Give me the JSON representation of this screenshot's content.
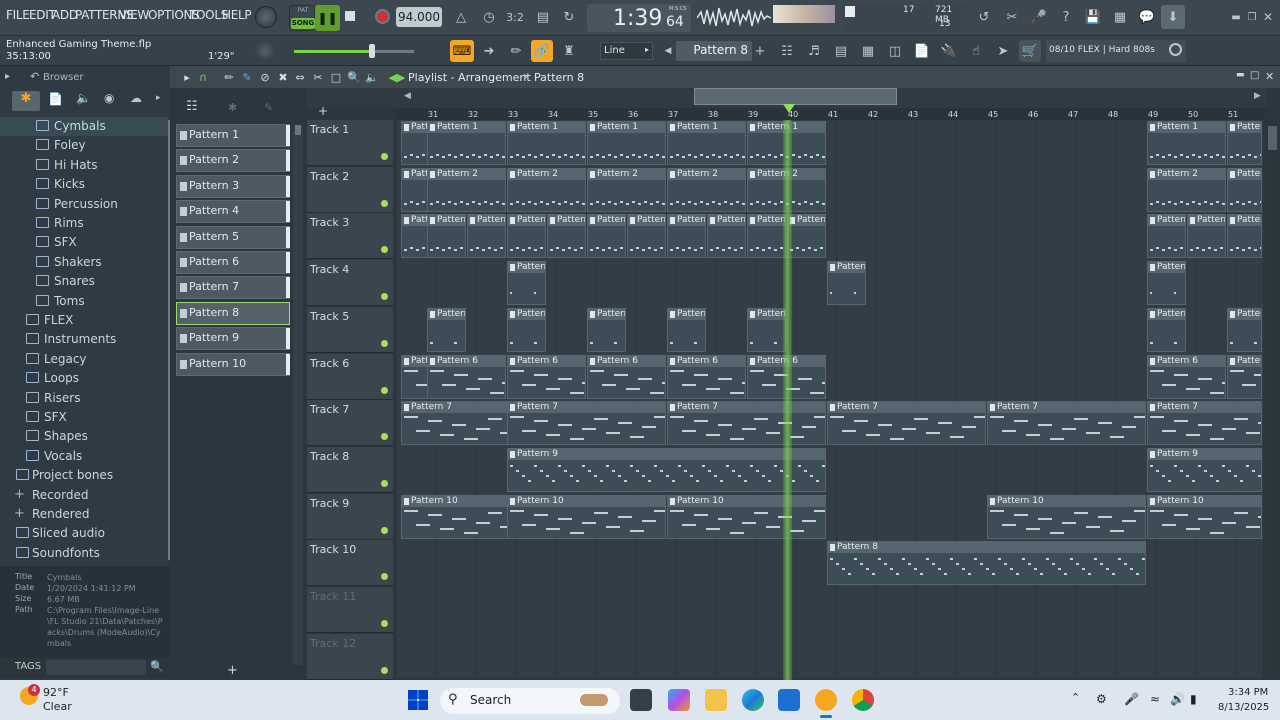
{
  "menu": [
    "FILE",
    "EDIT",
    "ADD",
    "PATTERNS",
    "VIEW",
    "OPTIONS",
    "TOOLS",
    "HELP"
  ],
  "transport": {
    "mode": "SONG",
    "pat_label": "PAT",
    "tempo": "94.000",
    "time": "1:39",
    "time_sub": "64",
    "time_unit": "M:S:CS"
  },
  "perf": {
    "voices": "17",
    "memory": "721 MB",
    "cpu": "13"
  },
  "project": {
    "file": "Enhanced Gaming Theme.flp",
    "time": "35:13:00",
    "length": "1'29\""
  },
  "snap": "Line",
  "pattern_selector": "Pattern 8",
  "plugin_hint": "08/10  FLEX | Hard 808s",
  "browser": {
    "title": "Browser",
    "items": [
      {
        "label": "Cymbals",
        "level": 2,
        "selected": true
      },
      {
        "label": "Foley",
        "level": 2
      },
      {
        "label": "Hi Hats",
        "level": 2
      },
      {
        "label": "Kicks",
        "level": 2
      },
      {
        "label": "Percussion",
        "level": 2
      },
      {
        "label": "Rims",
        "level": 2
      },
      {
        "label": "SFX",
        "level": 2
      },
      {
        "label": "Shakers",
        "level": 2
      },
      {
        "label": "Snares",
        "level": 2
      },
      {
        "label": "Toms",
        "level": 2
      },
      {
        "label": "FLEX",
        "level": 1
      },
      {
        "label": "Instruments",
        "level": 1
      },
      {
        "label": "Legacy",
        "level": 1
      },
      {
        "label": "Loops",
        "level": 1
      },
      {
        "label": "Risers",
        "level": 1
      },
      {
        "label": "SFX",
        "level": 1
      },
      {
        "label": "Shapes",
        "level": 1
      },
      {
        "label": "Vocals",
        "level": 1
      },
      {
        "label": "Project bones",
        "level": 0,
        "kind": "folder"
      },
      {
        "label": "Recorded",
        "level": 0,
        "kind": "plus"
      },
      {
        "label": "Rendered",
        "level": 0,
        "kind": "plus"
      },
      {
        "label": "Sliced audio",
        "level": 0,
        "kind": "folder"
      },
      {
        "label": "Soundfonts",
        "level": 0,
        "kind": "folder"
      }
    ],
    "info": [
      {
        "k": "Title",
        "v": "Cymbals"
      },
      {
        "k": "Date",
        "v": "1/20/2024 1:41:12 PM"
      },
      {
        "k": "Size",
        "v": "6.67 MB"
      },
      {
        "k": "Path",
        "v": "C:\\Program Files\\Image-Line\\FL Studio 21\\Data\\Patches\\Packs\\Drums (ModeAudio)\\Cymbals"
      }
    ],
    "tags_label": "TAGS"
  },
  "playlist": {
    "title": "Playlist - Arrangement",
    "pattern": "Pattern 8",
    "patterns": [
      "Pattern 1",
      "Pattern 2",
      "Pattern 3",
      "Pattern 4",
      "Pattern 5",
      "Pattern 6",
      "Pattern 7",
      "Pattern 8",
      "Pattern 9",
      "Pattern 10"
    ],
    "selected_pattern": "Pattern 8",
    "tracks": [
      "Track 1",
      "Track 2",
      "Track 3",
      "Track 4",
      "Track 5",
      "Track 6",
      "Track 7",
      "Track 8",
      "Track 9",
      "Track 10",
      "Track 11",
      "Track 12"
    ],
    "ruler": [
      "31",
      "32",
      "33",
      "34",
      "35",
      "36",
      "37",
      "38",
      "39",
      "40",
      "41",
      "42",
      "43",
      "44",
      "45",
      "46",
      "47",
      "48",
      "49",
      "50",
      "51"
    ],
    "playhead_bar": "40"
  },
  "taskbar": {
    "temp": "92°F",
    "weather": "Clear",
    "search": "Search",
    "time": "3:34 PM",
    "date": "8/13/2025",
    "badge": "4"
  },
  "colors": {
    "accent": "#f5a623",
    "play": "#6fc84b",
    "track_dot": "#a8e05e",
    "playhead": "#7bd34a"
  }
}
